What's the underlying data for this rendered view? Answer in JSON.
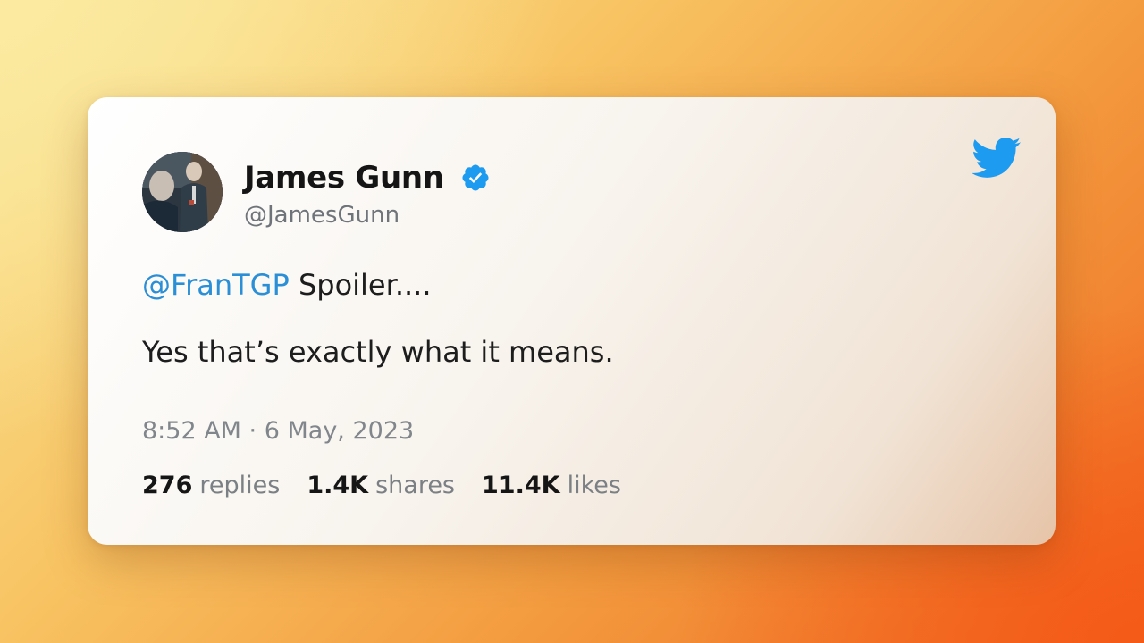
{
  "tweet": {
    "author": {
      "name": "James Gunn",
      "handle": "@JamesGunn",
      "verified": true,
      "avatar_icon": "avatar-photo"
    },
    "mention": "@FranTGP",
    "line1_text": " Spoiler....",
    "line2_text": "Yes that’s exactly what it means.",
    "timestamp": "8:52 AM · 6 May, 2023",
    "stats": [
      {
        "count": "276",
        "label": "replies"
      },
      {
        "count": "1.4K",
        "label": "shares"
      },
      {
        "count": "11.4K",
        "label": "likes"
      }
    ]
  },
  "brand_icon": "twitter-bird-icon",
  "colors": {
    "twitter_blue": "#1d9bf0",
    "mention_blue": "#2a8fd6"
  }
}
